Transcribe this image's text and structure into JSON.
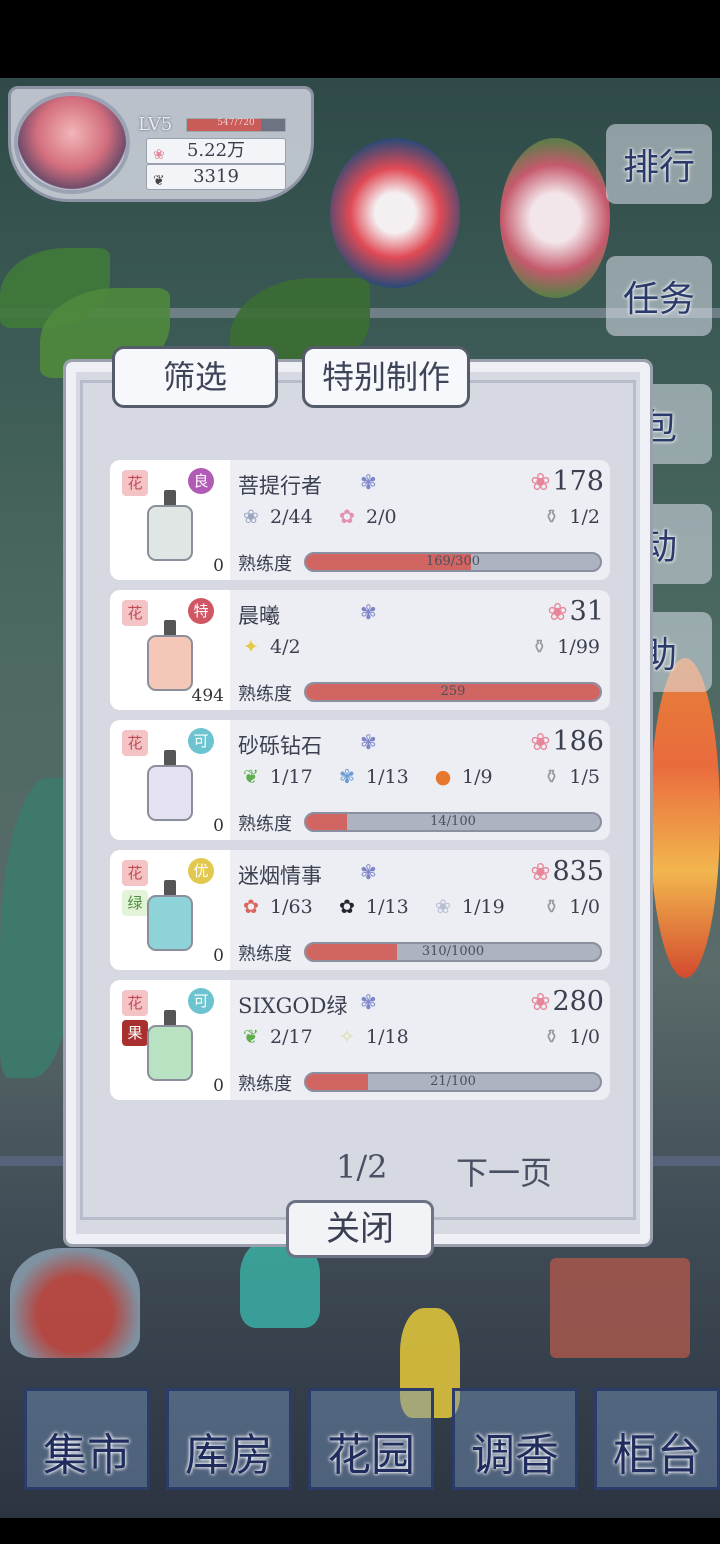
{
  "player": {
    "level": "LV5",
    "exp": "547/720",
    "exp_fraction": 0.76,
    "petals": "5.22万",
    "leaves": "3319"
  },
  "side_menu": [
    "排行",
    "任务",
    "包",
    "动",
    "助"
  ],
  "tabs": {
    "filter": "筛选",
    "special": "特别制作"
  },
  "recipes": [
    {
      "tag1": "花",
      "tag2": "",
      "tag2_color": "",
      "grade": "良",
      "grade_color": "#b15bb6",
      "name": "菩提行者",
      "stock": "0",
      "price": "178",
      "ingredients": [
        {
          "icon": "white-flower-icon",
          "glyph": "❀",
          "color": "#9aa7c3",
          "qty": "2/44"
        },
        {
          "icon": "pink-lily-icon",
          "glyph": "✿",
          "color": "#e38fb4",
          "qty": "2/0"
        }
      ],
      "product": "1/2",
      "proficiency": "169/300",
      "proficiency_fraction": 0.56,
      "bottle_color": "#dfe6e4"
    },
    {
      "tag1": "花",
      "tag2": "",
      "tag2_color": "",
      "grade": "特",
      "grade_color": "#d05664",
      "name": "晨曦",
      "stock": "494",
      "price": "31",
      "ingredients": [
        {
          "icon": "yellow-lily-icon",
          "glyph": "✦",
          "color": "#e7c94a",
          "qty": "4/2"
        }
      ],
      "product": "1/99",
      "proficiency": "259",
      "proficiency_fraction": 1.0,
      "bottle_color": "#f5c7b8"
    },
    {
      "tag1": "花",
      "tag2": "",
      "tag2_color": "",
      "grade": "可",
      "grade_color": "#6cc4d0",
      "name": "砂砾钻石",
      "stock": "0",
      "price": "186",
      "ingredients": [
        {
          "icon": "mint-leaf-icon",
          "glyph": "❦",
          "color": "#5fae4b",
          "qty": "1/17"
        },
        {
          "icon": "blue-flower-icon",
          "glyph": "✾",
          "color": "#6d9bd4",
          "qty": "1/13"
        },
        {
          "icon": "orange-fruit-icon",
          "glyph": "●",
          "color": "#e7772d",
          "qty": "1/9"
        }
      ],
      "product": "1/5",
      "proficiency": "14/100",
      "proficiency_fraction": 0.14,
      "bottle_color": "#e4e2f3"
    },
    {
      "tag1": "花",
      "tag2": "绿",
      "tag2_color": "#e2f3d8",
      "grade": "优",
      "grade_color": "#e2c84f",
      "name": "迷烟情事",
      "stock": "0",
      "price": "835",
      "ingredients": [
        {
          "icon": "red-rose-icon",
          "glyph": "✿",
          "color": "#d9655d",
          "qty": "1/63"
        },
        {
          "icon": "black-rose-icon",
          "glyph": "✿",
          "color": "#22252e",
          "qty": "1/13"
        },
        {
          "icon": "white-rose-icon",
          "glyph": "❀",
          "color": "#b8bfd2",
          "qty": "1/19"
        }
      ],
      "product": "1/0",
      "proficiency": "310/1000",
      "proficiency_fraction": 0.31,
      "bottle_color": "#8ed3d8"
    },
    {
      "tag1": "花",
      "tag2": "果",
      "tag2_color": "#a8302f",
      "grade": "可",
      "grade_color": "#6cc4d0",
      "name": "SIXGOD绿",
      "stock": "0",
      "price": "280",
      "ingredients": [
        {
          "icon": "mint-leaf-icon",
          "glyph": "❦",
          "color": "#5fae4b",
          "qty": "2/17"
        },
        {
          "icon": "white-sprig-icon",
          "glyph": "✧",
          "color": "#d8dca4",
          "qty": "1/18"
        }
      ],
      "product": "1/0",
      "proficiency": "21/100",
      "proficiency_fraction": 0.21,
      "bottle_color": "#b9e2c2"
    }
  ],
  "proficiency_label": "熟练度",
  "pager": {
    "page": "1/2",
    "next": "下一页"
  },
  "close_label": "关闭",
  "bottom_nav": [
    "集市",
    "库房",
    "花园",
    "调香",
    "柜台"
  ]
}
